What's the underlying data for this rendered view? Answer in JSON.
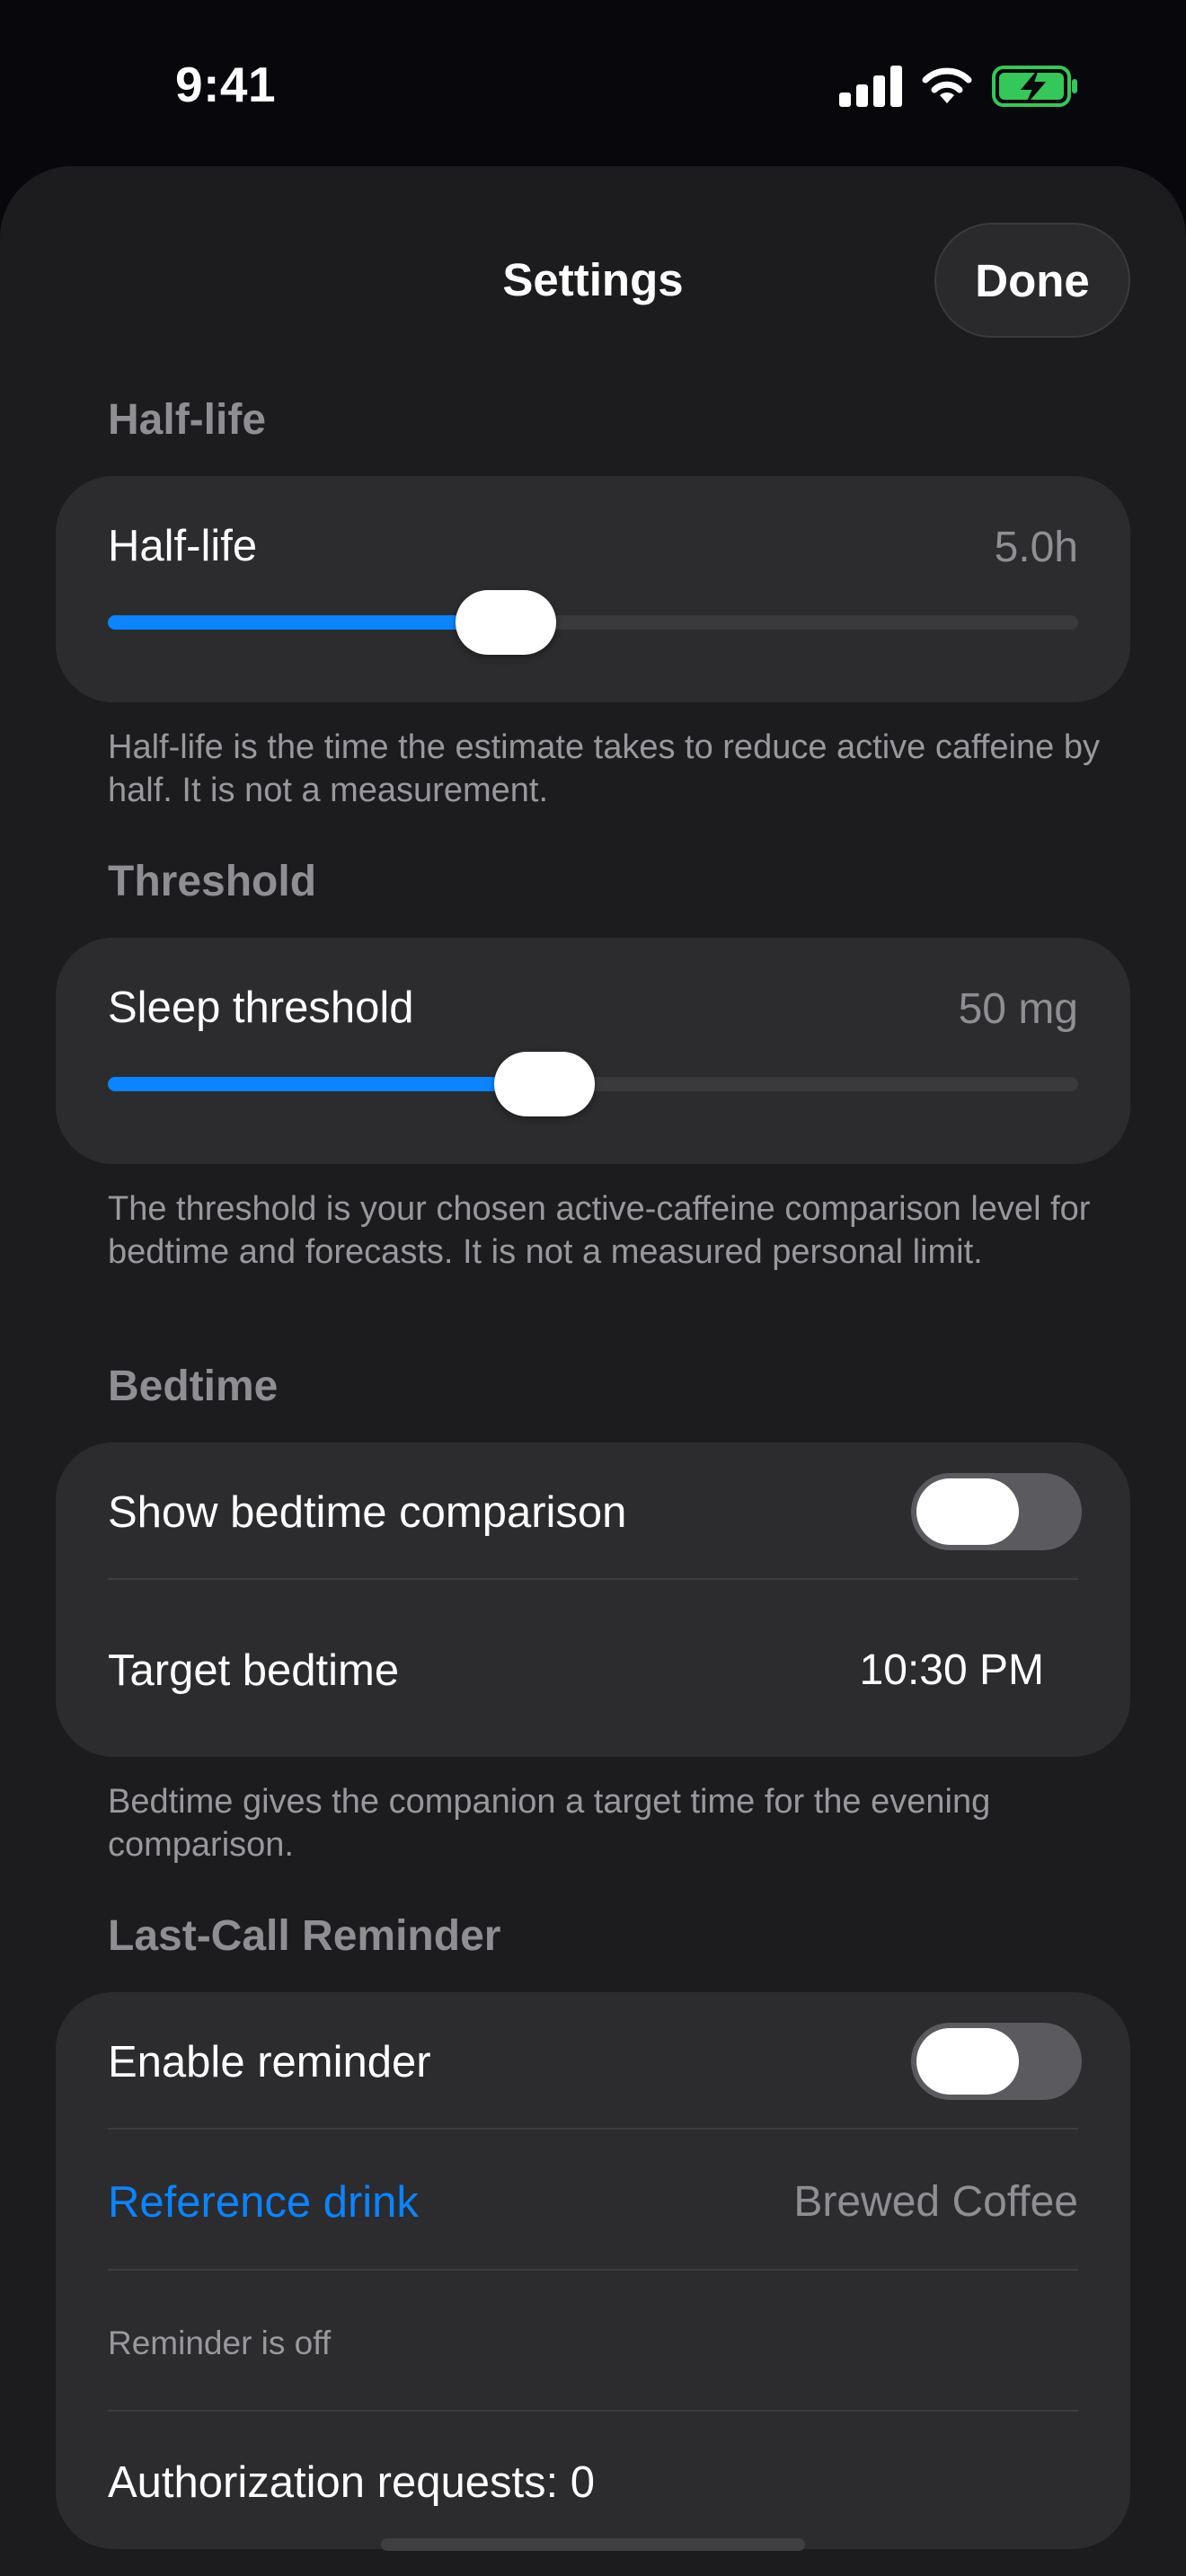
{
  "status_bar": {
    "time": "9:41",
    "icons": [
      "cellular-signal-icon",
      "wifi-icon",
      "battery-charging-icon"
    ]
  },
  "sheet": {
    "title": "Settings",
    "done_label": "Done"
  },
  "half_life": {
    "section_title": "Half-life",
    "label": "Half-life",
    "value": "5.0h",
    "slider_fraction": 0.41,
    "footnote": "Half-life is the time the estimate takes to reduce active caffeine by half. It is not a measurement."
  },
  "threshold": {
    "section_title": "Threshold",
    "label": "Sleep threshold",
    "value": "50 mg",
    "slider_fraction": 0.45,
    "footnote": "The threshold is your chosen active-caffeine comparison level for bedtime and forecasts. It is not a measured personal limit."
  },
  "bedtime": {
    "section_title": "Bedtime",
    "show_comparison_label": "Show bedtime comparison",
    "show_comparison_on": false,
    "target_label": "Target bedtime",
    "target_value": "10:30 PM",
    "footnote": "Bedtime gives the companion a target time for the evening comparison."
  },
  "reminder": {
    "section_title": "Last-Call Reminder",
    "enable_label": "Enable reminder",
    "enable_on": false,
    "reference_label": "Reference drink",
    "reference_value": "Brewed Coffee",
    "status_text": "Reminder is off",
    "authorization_text": "Authorization requests: 0"
  },
  "colors": {
    "accent": "#0a84ff",
    "background": "#1c1c1e",
    "card": "#2c2c2e",
    "battery": "#34c759"
  }
}
